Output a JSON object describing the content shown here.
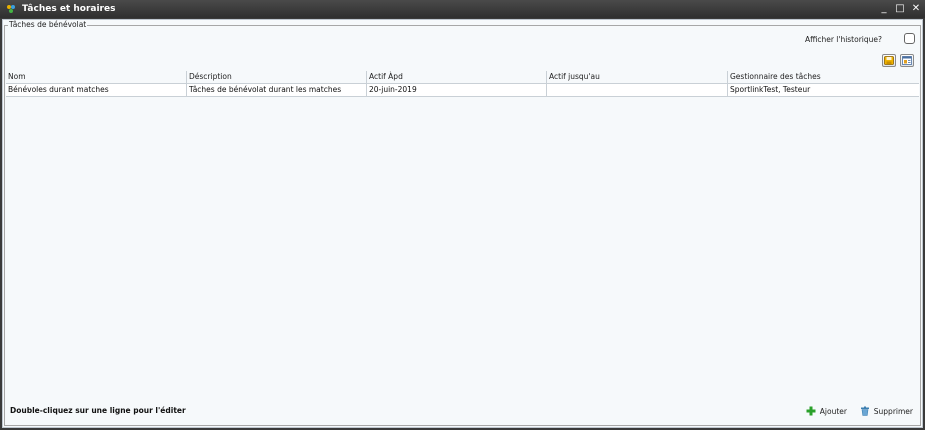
{
  "window": {
    "title": "Tâches et horaires",
    "minimize_glyph": "_",
    "maximize_glyph": "□",
    "close_glyph": "✕"
  },
  "group": {
    "legend": "Tâches de bénévolat"
  },
  "history": {
    "label": "Afficher l'historique?",
    "checked": false
  },
  "toolbar": {
    "icons": [
      "save-icon",
      "export-icon"
    ]
  },
  "table": {
    "columns": [
      "Nom",
      "Déscription",
      "Actif Àpd",
      "Actif jusqu'au",
      "Gestionnaire des tâches"
    ],
    "rows": [
      [
        "Bénévoles durant matches",
        "Tâches de bénévolat durant les matches",
        "20-juin-2019",
        "",
        "SportlinkTest, Testeur"
      ]
    ]
  },
  "footer": {
    "hint": "Double-cliquez sur une ligne pour l'éditer",
    "add_label": "Ajouter",
    "delete_label": "Supprimer"
  },
  "colors": {
    "titlebar": "#3a3a3a",
    "content_bg": "#f6f9fb",
    "add_icon": "#2aa02a",
    "delete_icon": "#3c7fb1"
  }
}
